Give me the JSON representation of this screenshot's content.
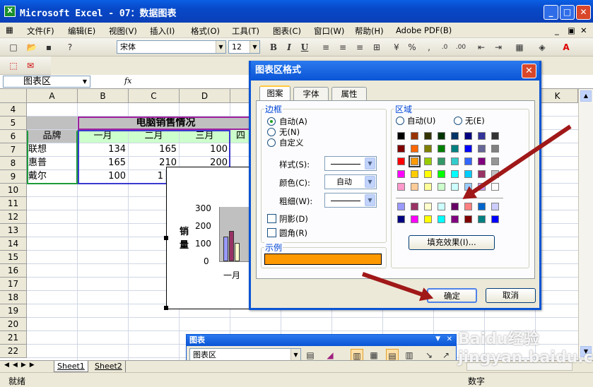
{
  "window": {
    "title": "Microsoft Excel - 07：数据图表",
    "app_icon": "excel-icon"
  },
  "menu": [
    "文件(F)",
    "编辑(E)",
    "视图(V)",
    "插入(I)",
    "格式(O)",
    "工具(T)",
    "图表(C)",
    "窗口(W)",
    "帮助(H)",
    "Adobe PDF(B)"
  ],
  "toolbar": {
    "font": "宋体",
    "size": "12",
    "bold": "B",
    "italic": "I",
    "underline": "U"
  },
  "namebox": "图表区",
  "fx": "fx",
  "columns": [
    "A",
    "B",
    "C",
    "D",
    "K"
  ],
  "rows": [
    "4",
    "5",
    "6",
    "7",
    "8",
    "9",
    "10",
    "11",
    "12",
    "13",
    "14",
    "15",
    "16",
    "17",
    "18",
    "19",
    "20",
    "21",
    "22"
  ],
  "sheet": {
    "title": "电脑销售情况",
    "header": [
      "品牌",
      "一月",
      "二月",
      "三月",
      "四"
    ],
    "data": [
      {
        "brand": "联想",
        "jan": "134",
        "feb": "165",
        "mar": "100"
      },
      {
        "brand": "惠普",
        "jan": "165",
        "feb": "210",
        "mar": "200"
      },
      {
        "brand": "戴尔",
        "jan": "100",
        "feb": "1"
      }
    ]
  },
  "chart": {
    "ylabel": "销量",
    "yticks": [
      "300",
      "200",
      "100",
      "0"
    ],
    "xlabel": "一月"
  },
  "dialog": {
    "title": "图表区格式",
    "tabs": [
      "图案",
      "字体",
      "属性"
    ],
    "border": {
      "label": "边框",
      "auto": "自动(A)",
      "none": "无(N)",
      "custom": "自定义",
      "style_label": "样式(S):",
      "color_label": "颜色(C):",
      "color_value": "自动",
      "weight_label": "粗细(W):",
      "shadow": "阴影(D)",
      "round": "圆角(R)"
    },
    "area": {
      "label": "区域",
      "auto": "自动(U)",
      "none": "无(E)",
      "fill_effects": "填充效果(I)..."
    },
    "sample": {
      "label": "示例",
      "color": "#ff9900"
    },
    "ok": "确定",
    "cancel": "取消"
  },
  "palette": {
    "main": [
      [
        "#000000",
        "#993300",
        "#333300",
        "#003300",
        "#003366",
        "#000080",
        "#333399",
        "#333333"
      ],
      [
        "#800000",
        "#ff6600",
        "#808000",
        "#008000",
        "#008080",
        "#0000ff",
        "#666699",
        "#808080"
      ],
      [
        "#ff0000",
        "#ff9900",
        "#99cc00",
        "#339966",
        "#33cccc",
        "#3366ff",
        "#800080",
        "#969696"
      ],
      [
        "#ff00ff",
        "#ffcc00",
        "#ffff00",
        "#00ff00",
        "#00ffff",
        "#00ccff",
        "#993366",
        "#c0c0c0"
      ],
      [
        "#ff99cc",
        "#ffcc99",
        "#ffff99",
        "#ccffcc",
        "#ccffff",
        "#99ccff",
        "#cc99ff",
        "#ffffff"
      ]
    ],
    "extra": [
      [
        "#9999ff",
        "#993366",
        "#ffffcc",
        "#ccffff",
        "#660066",
        "#ff8080",
        "#0066cc",
        "#ccccff"
      ],
      [
        "#000080",
        "#ff00ff",
        "#ffff00",
        "#00ffff",
        "#800080",
        "#800000",
        "#008080",
        "#0000ff"
      ]
    ],
    "selected": "#ff9900"
  },
  "chart_toolbar": {
    "title": "图表",
    "select": "图表区"
  },
  "sheet_tabs": [
    "Sheet1",
    "Sheet2"
  ],
  "status": {
    "left": "就绪",
    "right": "数字"
  },
  "watermark": "Baidu经验 jingyan.baidu.com"
}
